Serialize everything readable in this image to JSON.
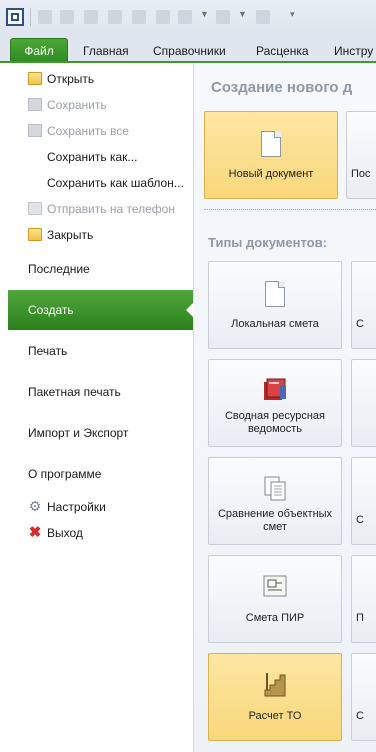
{
  "ribbon": {
    "tabs": [
      "Файл",
      "Главная",
      "Справочники",
      "Расценка",
      "Инстру"
    ]
  },
  "nav": {
    "file_items": [
      {
        "label": "Открыть",
        "icon": "folder-open-icon",
        "enabled": true
      },
      {
        "label": "Сохранить",
        "icon": "save-icon",
        "enabled": false
      },
      {
        "label": "Сохранить все",
        "icon": "save-all-icon",
        "enabled": false
      },
      {
        "label": "Сохранить как...",
        "icon": "",
        "enabled": true
      },
      {
        "label": "Сохранить как шаблон...",
        "icon": "",
        "enabled": true
      },
      {
        "label": "Отправить на телефон",
        "icon": "phone-icon",
        "enabled": false
      },
      {
        "label": "Закрыть",
        "icon": "folder-close-icon",
        "enabled": true
      }
    ],
    "sections": [
      "Последние",
      "Создать",
      "Печать",
      "Пакетная печать",
      "Импорт и Экспорт",
      "О программе"
    ],
    "active_section": "Создать",
    "bottom_items": [
      {
        "label": "Настройки",
        "icon": "gear-icon"
      },
      {
        "label": "Выход",
        "icon": "exit-icon"
      }
    ]
  },
  "main": {
    "title": "Создание нового д",
    "top_cards": [
      {
        "label": "Новый документ",
        "selected": true
      },
      {
        "label": "Пос",
        "selected": false
      }
    ],
    "types_title": "Типы документов:",
    "type_cards": [
      {
        "label": "Локальная смета",
        "icon": "document-icon",
        "selected": false
      },
      {
        "label": "Сводная ресурсная ведомость",
        "icon": "resource-book-icon",
        "selected": false
      },
      {
        "label": "Сравнение объектных смет",
        "icon": "compare-docs-icon",
        "selected": false
      },
      {
        "label": "Смета ПИР",
        "icon": "blueprint-icon",
        "selected": false
      },
      {
        "label": "Расчет ТО",
        "icon": "staircase-icon",
        "selected": true
      }
    ],
    "right_partials": [
      "С",
      "",
      "С",
      "П",
      "С"
    ]
  }
}
